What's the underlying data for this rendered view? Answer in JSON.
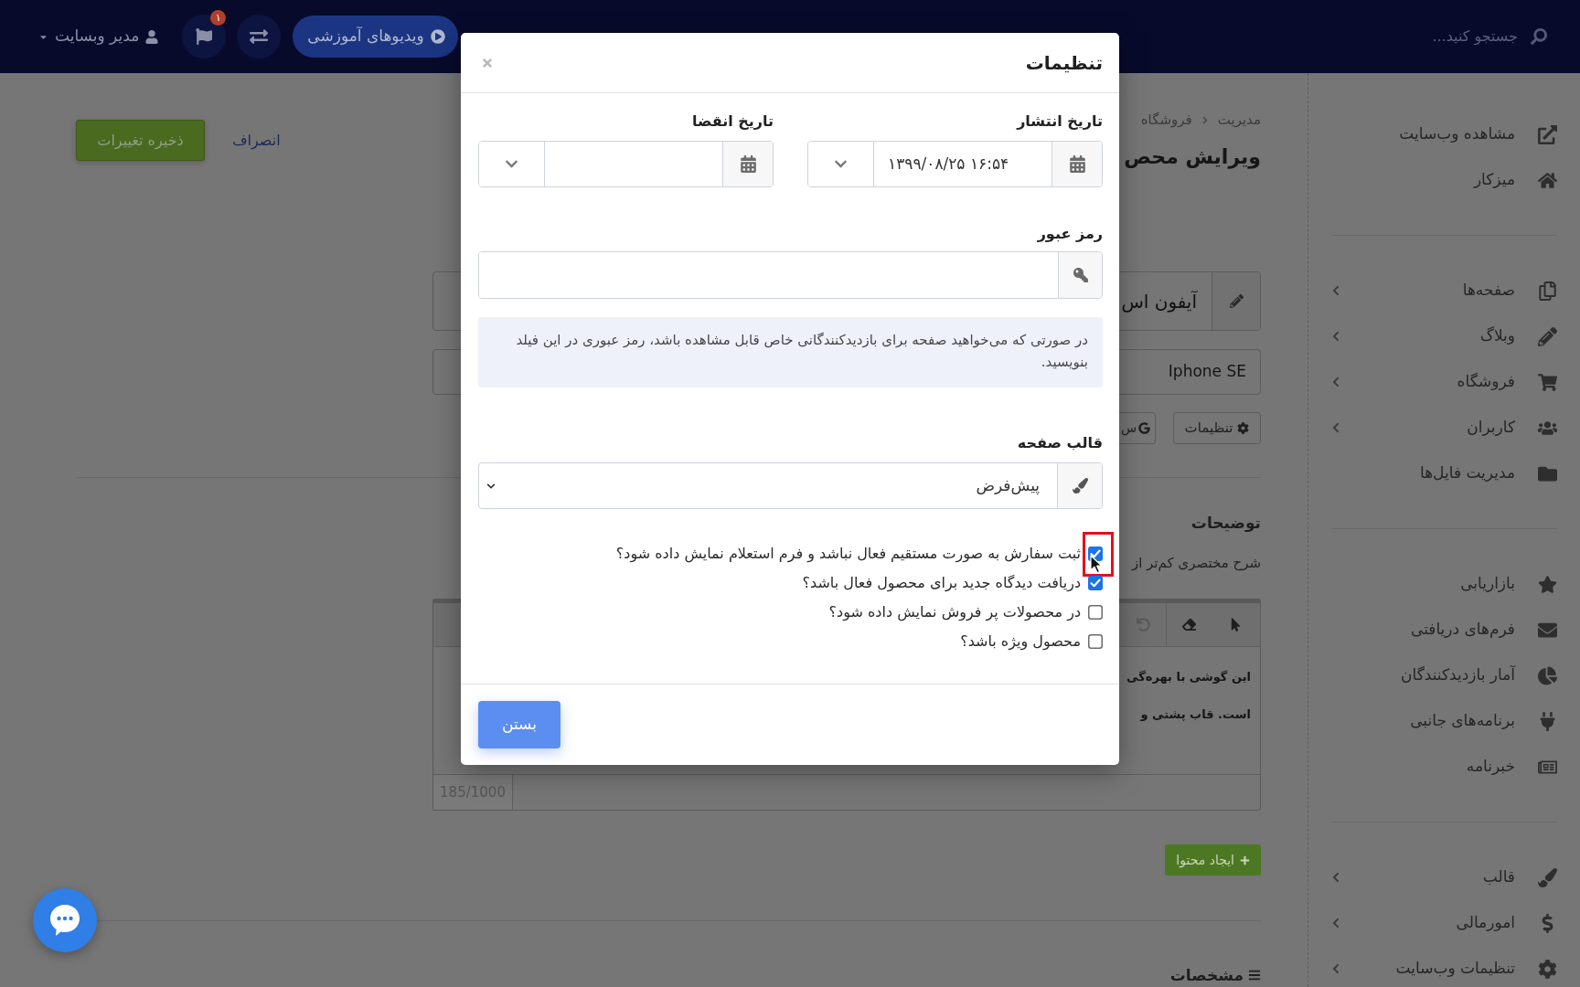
{
  "top_bar": {
    "search": {
      "placeholder": "جستجو کنید..."
    },
    "tutorial_button": {
      "label": "ویدیوهای آموزشی"
    },
    "notifications": {
      "badge": "۱"
    },
    "user_menu": {
      "label": "مدیر وبسایت"
    }
  },
  "sidebar": {
    "groups": [
      {
        "items": [
          {
            "label": "مشاهده وب‌سایت",
            "expandable": false
          },
          {
            "label": "میزکار",
            "expandable": false
          }
        ]
      },
      {
        "items": [
          {
            "label": "صفحه‌ها",
            "expandable": true
          },
          {
            "label": "وبلاگ",
            "expandable": true
          },
          {
            "label": "فروشگاه",
            "expandable": true
          },
          {
            "label": "کاربران",
            "expandable": true
          },
          {
            "label": "مدیریت فایل‌ها",
            "expandable": false
          }
        ]
      },
      {
        "items": [
          {
            "label": "بازاریابی",
            "expandable": false
          },
          {
            "label": "فرم‌های دریافتی",
            "expandable": false
          },
          {
            "label": "آمار بازدیدکنندگان",
            "expandable": false
          },
          {
            "label": "برنامه‌های جانبی",
            "expandable": false
          },
          {
            "label": "خبرنامه",
            "expandable": false
          }
        ]
      },
      {
        "items": [
          {
            "label": "قالب",
            "expandable": true
          },
          {
            "label": "امورمالی",
            "expandable": true
          },
          {
            "label": "تنظیمات وب‌سایت",
            "expandable": true
          }
        ]
      }
    ]
  },
  "page": {
    "breadcrumb": [
      "مدیریت",
      "فروشگاه"
    ],
    "title": "ویرایش محص",
    "actions": {
      "cancel": "انصراف",
      "save": "ذخیره تغییرات"
    },
    "product_name": {
      "value": "آیفون اس"
    },
    "slug": {
      "value": "Iphone SE"
    },
    "tool_buttons": [
      {
        "label": "تنظیمات"
      },
      {
        "label": "س"
      }
    ],
    "description": {
      "heading": "توضیحات",
      "hint": "شرح مختصری کم‌تر از",
      "editor": {
        "toolbar": [
          {
            "disabled": false
          },
          {
            "disabled": false
          },
          {
            "disabled": true
          }
        ],
        "lines": [
          "این گوشی با بهره‌گی",
          "است. قاب پشتی و"
        ],
        "counter": "185/1000"
      }
    },
    "add_content_button": "ایجاد محتوا",
    "specs_heading": "مشخصات"
  },
  "modal": {
    "title": "تنظیمات",
    "dates": [
      {
        "label": "تاریخ انتشار",
        "value": "۱۳۹۹/۰۸/۲۵ ۱۶:۵۴"
      },
      {
        "label": "تاریخ انقضا"
      }
    ],
    "password": {
      "label": "رمز عبور"
    },
    "password_note": "در صورتی که می‌خواهید صفحه برای بازدیدکنندگانی خاص قابل مشاهده باشد، رمز عبوری در این فیلد بنویسید.",
    "template": {
      "label": "قالب صفحه",
      "value": "پیش‌فرض"
    },
    "options": [
      {
        "label": "ثبت سفارش به صورت مستقیم فعال نباشد و فرم استعلام نمایش داده شود؟",
        "checked": true,
        "highlighted": true
      },
      {
        "label": "دریافت دیدگاه جدید برای محصول فعال باشد؟",
        "checked": true,
        "highlighted": false
      },
      {
        "label": "در محصولات پر فروش نمایش داده شود؟",
        "checked": false,
        "highlighted": false
      },
      {
        "label": "محصول ویژه باشد؟",
        "checked": false,
        "highlighted": false
      }
    ],
    "close_button": "بستن"
  }
}
